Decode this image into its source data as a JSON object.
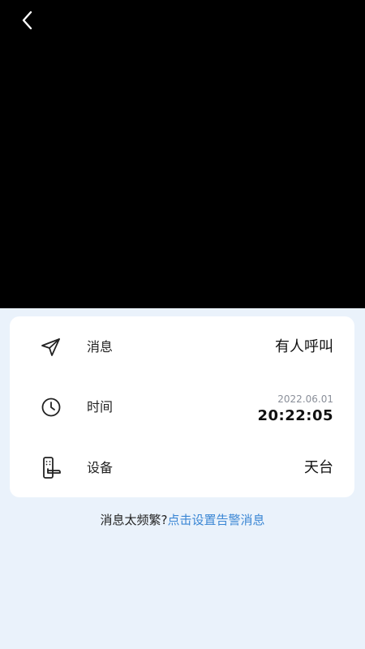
{
  "header": {
    "back_icon": "chevron-left-icon"
  },
  "colors": {
    "video_bg": "#000000",
    "page_bg": "#EAF2FB",
    "card_bg": "#FFFFFF",
    "link": "#3A86D4",
    "date_text": "#8A8F99"
  },
  "info": {
    "message": {
      "icon": "send-icon",
      "label": "消息",
      "value": "有人呼叫"
    },
    "time": {
      "icon": "clock-icon",
      "label": "时间",
      "date": "2022.06.01",
      "clock": "20:22:05"
    },
    "device": {
      "icon": "door-lock-icon",
      "label": "设备",
      "value": "天台"
    }
  },
  "tip": {
    "text": "消息太频繁?",
    "link": "点击设置告警消息"
  }
}
